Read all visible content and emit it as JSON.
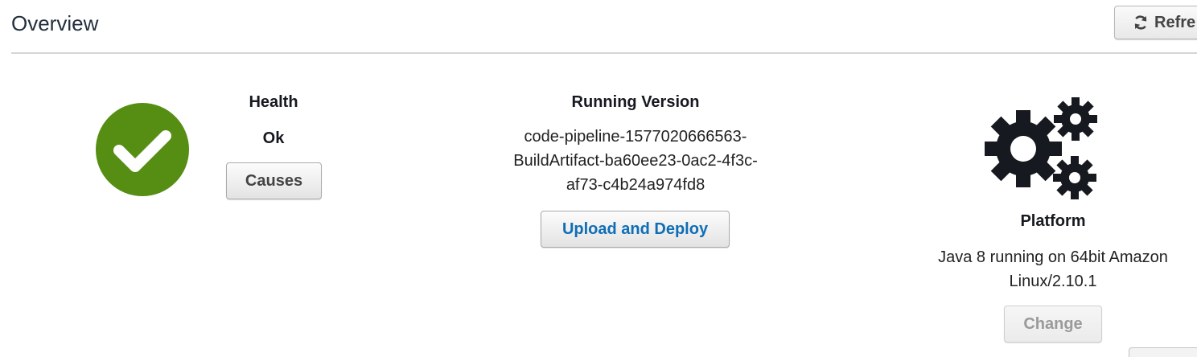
{
  "header": {
    "title": "Overview",
    "refresh_label": "Refre"
  },
  "health": {
    "title": "Health",
    "status": "Ok",
    "status_color": "#568e14",
    "causes_label": "Causes"
  },
  "running_version": {
    "title": "Running Version",
    "version_lines": [
      "code-pipeline-1577020666563-",
      "BuildArtifact-ba60ee23-0ac2-4f3c-",
      "af73-c4b24a974fd8"
    ],
    "upload_label": "Upload and Deploy"
  },
  "platform": {
    "title": "Platform",
    "description_lines": [
      "Java 8 running on 64bit Amazon",
      "Linux/2.10.1"
    ],
    "change_label": "Change"
  },
  "colors": {
    "link_blue": "#0f6eb5",
    "icon_dark": "#16191f"
  }
}
